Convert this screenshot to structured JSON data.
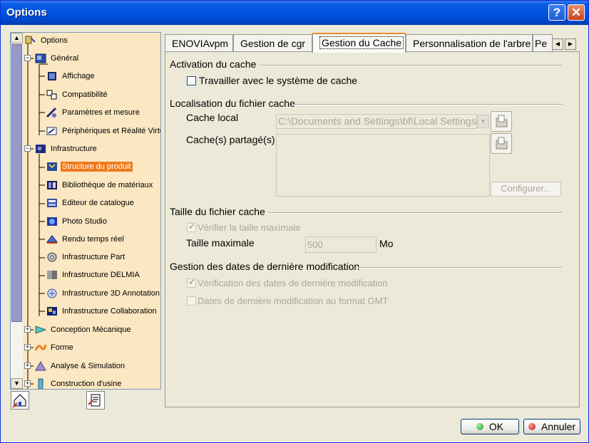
{
  "window": {
    "title": "Options",
    "help_icon": "question-mark-icon",
    "close_icon": "close-icon"
  },
  "tree": {
    "items": [
      {
        "label": "Options",
        "icon": "options-icon",
        "level": 0
      },
      {
        "label": "Général",
        "icon": "general-icon",
        "level": 1
      },
      {
        "label": "Affichage",
        "icon": "display-icon",
        "level": 2
      },
      {
        "label": "Compatibilité",
        "icon": "compatibility-icon",
        "level": 2
      },
      {
        "label": "Paramètres et mesure",
        "icon": "parameters-icon",
        "level": 2
      },
      {
        "label": "Périphériques et Réalité Virtue",
        "icon": "devices-icon",
        "level": 2
      },
      {
        "label": "Infrastructure",
        "icon": "infrastructure-icon",
        "level": 1
      },
      {
        "label": "Structure du produit",
        "icon": "product-structure-icon",
        "level": 2,
        "selected": true
      },
      {
        "label": "Bibliothèque de matériaux",
        "icon": "material-library-icon",
        "level": 2
      },
      {
        "label": "Editeur de catalogue",
        "icon": "catalog-editor-icon",
        "level": 2
      },
      {
        "label": "Photo Studio",
        "icon": "photo-studio-icon",
        "level": 2
      },
      {
        "label": "Rendu temps réel",
        "icon": "realtime-render-icon",
        "level": 2
      },
      {
        "label": "Infrastructure Part",
        "icon": "part-infrastructure-icon",
        "level": 2
      },
      {
        "label": "Infrastructure DELMIA",
        "icon": "delmia-infrastructure-icon",
        "level": 2
      },
      {
        "label": "Infrastructure 3D Annotation",
        "icon": "annotation-3d-icon",
        "level": 2
      },
      {
        "label": "Infrastructure Collaboration",
        "icon": "collaboration-icon",
        "level": 2
      },
      {
        "label": "Conception Mécanique",
        "icon": "mechanical-design-icon",
        "level": 1
      },
      {
        "label": "Forme",
        "icon": "shape-icon",
        "level": 1
      },
      {
        "label": "Analyse & Simulation",
        "icon": "analysis-simulation-icon",
        "level": 1
      },
      {
        "label": "Construction d'usine",
        "icon": "plant-construction-icon",
        "level": 1
      }
    ]
  },
  "tabs": [
    {
      "label": "ENOVIAvpm"
    },
    {
      "label": "Gestion de cgr"
    },
    {
      "label": "Gestion du Cache",
      "active": true
    },
    {
      "label": "Personnalisation de l'arbre"
    },
    {
      "label": "Pe"
    }
  ],
  "sections": {
    "activation": {
      "title": "Activation du cache",
      "work_with_cache": "Travailler avec le système de cache"
    },
    "location": {
      "title": "Localisation du fichier cache",
      "local_label": "Cache local",
      "local_value": "C:\\Documents and Settings\\bf\\Local Settings\\",
      "shared_label": "Cache(s) partagé(s)",
      "configure_button": "Configurer..."
    },
    "size": {
      "title": "Taille du fichier cache",
      "check_max": "Vérifier la taille maximale",
      "max_label": "Taille maximale",
      "max_value": "500",
      "unit": "Mo"
    },
    "dates": {
      "title": "Gestion des dates de dernière modification",
      "check_dates": "Vérification des dates de dernière modification",
      "gmt_dates": "Dates de dernière modification au format GMT"
    }
  },
  "footer": {
    "ok": "OK",
    "cancel": "Annuler"
  }
}
